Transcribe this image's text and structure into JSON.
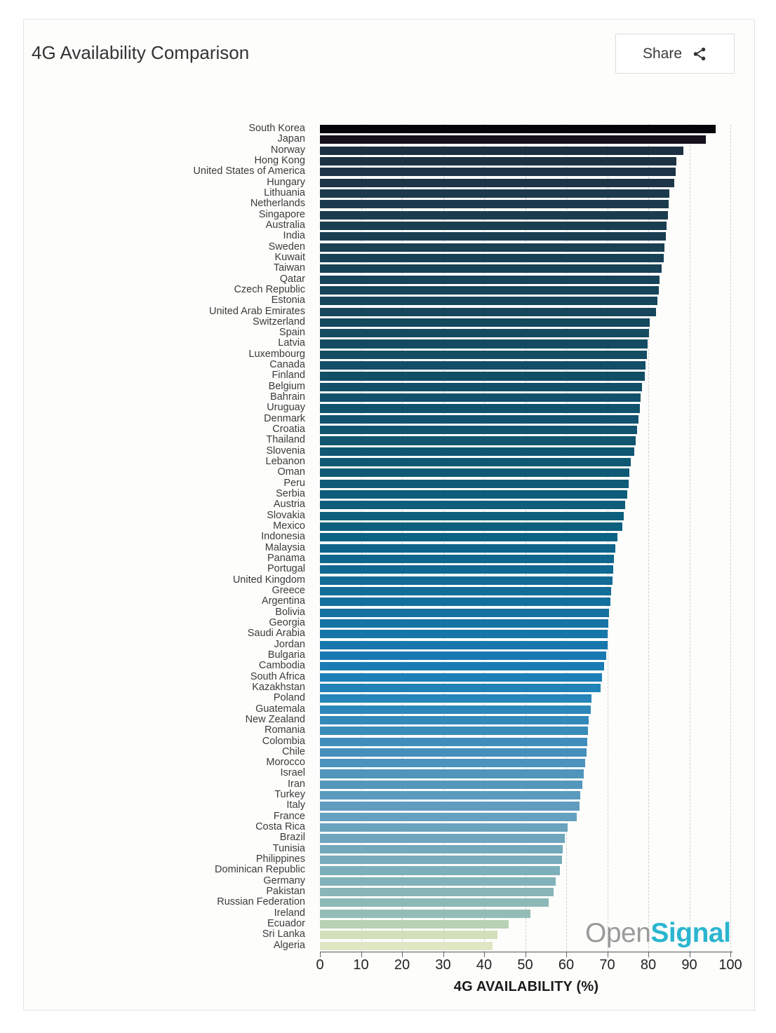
{
  "header": {
    "title": "4G Availability Comparison",
    "share_label": "Share",
    "share_icon": "share-icon"
  },
  "logo": {
    "part1": "Open",
    "part2": "Signal",
    "part1_color": "#9a9a9a",
    "part2_color": "#2ab5d0"
  },
  "chart_data": {
    "type": "bar",
    "orientation": "horizontal",
    "title": "4G Availability Comparison",
    "xlabel": "4G AVAILABILITY (%)",
    "ylabel": "",
    "xlim": [
      0,
      100
    ],
    "xticks": [
      0,
      10,
      20,
      30,
      40,
      50,
      60,
      70,
      80,
      90,
      100
    ],
    "grid": "vertical-dashed",
    "legend": "none",
    "categories": [
      "South Korea",
      "Japan",
      "Norway",
      "Hong Kong",
      "United States of America",
      "Hungary",
      "Lithuania",
      "Netherlands",
      "Singapore",
      "Australia",
      "India",
      "Sweden",
      "Kuwait",
      "Taiwan",
      "Qatar",
      "Czech Republic",
      "Estonia",
      "United Arab Emirates",
      "Switzerland",
      "Spain",
      "Latvia",
      "Luxembourg",
      "Canada",
      "Finland",
      "Belgium",
      "Bahrain",
      "Uruguay",
      "Denmark",
      "Croatia",
      "Thailand",
      "Slovenia",
      "Lebanon",
      "Oman",
      "Peru",
      "Serbia",
      "Austria",
      "Slovakia",
      "Mexico",
      "Indonesia",
      "Malaysia",
      "Panama",
      "Portugal",
      "United Kingdom",
      "Greece",
      "Argentina",
      "Bolivia",
      "Georgia",
      "Saudi Arabia",
      "Jordan",
      "Bulgaria",
      "Cambodia",
      "South Africa",
      "Kazakhstan",
      "Poland",
      "Guatemala",
      "New Zealand",
      "Romania",
      "Colombia",
      "Chile",
      "Morocco",
      "Israel",
      "Iran",
      "Turkey",
      "Italy",
      "France",
      "Costa Rica",
      "Brazil",
      "Tunisia",
      "Philippines",
      "Dominican Republic",
      "Germany",
      "Pakistan",
      "Russian Federation",
      "Ireland",
      "Ecuador",
      "Sri Lanka",
      "Algeria"
    ],
    "values": [
      96.4,
      94.1,
      88.5,
      86.9,
      86.7,
      86.4,
      85.2,
      85.0,
      84.8,
      84.5,
      84.2,
      84.0,
      83.7,
      83.3,
      82.8,
      82.5,
      82.3,
      81.8,
      80.4,
      80.2,
      79.9,
      79.6,
      79.4,
      79.2,
      78.5,
      78.2,
      78.0,
      77.6,
      77.3,
      77.0,
      76.5,
      75.8,
      75.4,
      75.2,
      74.9,
      74.4,
      74.0,
      73.6,
      72.5,
      72.0,
      71.6,
      71.4,
      71.2,
      71.0,
      70.8,
      70.5,
      70.3,
      70.1,
      70.0,
      69.8,
      69.2,
      68.8,
      68.3,
      66.2,
      65.9,
      65.5,
      65.3,
      65.1,
      65.0,
      64.7,
      64.3,
      63.9,
      63.5,
      63.2,
      62.5,
      60.3,
      59.6,
      59.2,
      59.0,
      58.4,
      57.4,
      57.0,
      55.8,
      51.2,
      46.0,
      43.2,
      42.0
    ],
    "bar_colors": [
      "#06060a",
      "#16101c",
      "#1c3042",
      "#1d3345",
      "#1d3446",
      "#1d3547",
      "#1b3a4c",
      "#1b3b4d",
      "#1a3c4e",
      "#1a3d50",
      "#193e51",
      "#194053",
      "#184155",
      "#184257",
      "#174459",
      "#17455a",
      "#16465c",
      "#16475d",
      "#154960",
      "#154a61",
      "#144b63",
      "#144c64",
      "#134d66",
      "#134e67",
      "#125069",
      "#12516b",
      "#11526c",
      "#11536e",
      "#10556f",
      "#105671",
      "#0f5773",
      "#0f5874",
      "#0e5a76",
      "#0e5b78",
      "#0d5c79",
      "#0d5d7b",
      "#0c5f7d",
      "#0c607e",
      "#0d6384",
      "#0e6589",
      "#0f678d",
      "#106991",
      "#116b95",
      "#126d99",
      "#136f9d",
      "#1471a1",
      "#1573a5",
      "#1675a9",
      "#1777ad",
      "#1879b1",
      "#1b7cb4",
      "#1e7fb6",
      "#2182b8",
      "#2785b9",
      "#2d88ba",
      "#3389ba",
      "#3a8cba",
      "#3f8ebb",
      "#4590bb",
      "#4a93bc",
      "#4f95bc",
      "#5497bd",
      "#5a9abd",
      "#5f9cbe",
      "#64a0bf",
      "#69a3be",
      "#6ea6bd",
      "#73a9bc",
      "#78acbb",
      "#7dafba",
      "#82b2b9",
      "#87b5b8",
      "#8cb8b7",
      "#93bcb6",
      "#b8d1b4",
      "#d3dfbb",
      "#dfe6c4"
    ]
  }
}
